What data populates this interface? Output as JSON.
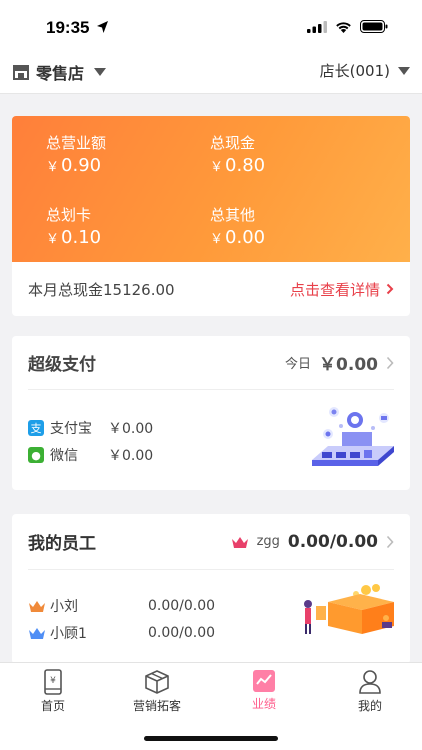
{
  "status_bar": {
    "time": "19:35"
  },
  "nav": {
    "store": "零售店",
    "role": "店长(001)"
  },
  "revenue": {
    "items": [
      {
        "label": "总营业额",
        "currency": "￥",
        "value": "0.90"
      },
      {
        "label": "总现金",
        "currency": "￥",
        "value": "0.80"
      },
      {
        "label": "总划卡",
        "currency": "￥",
        "value": "0.10"
      },
      {
        "label": "总其他",
        "currency": "￥",
        "value": "0.00"
      }
    ],
    "monthly_cash": "本月总现金15126.00",
    "detail_link": "点击查看详情"
  },
  "super_pay": {
    "title": "超级支付",
    "today_label": "今日",
    "today_value": "￥0.00",
    "rows": [
      {
        "name": "支付宝",
        "value": "￥0.00"
      },
      {
        "name": "微信",
        "value": "￥0.00"
      }
    ]
  },
  "staff": {
    "title": "我的员工",
    "lead_name": "zgg",
    "lead_value": "0.00/0.00",
    "rows": [
      {
        "name": "小刘",
        "value": "0.00/0.00"
      },
      {
        "name": "小顾1",
        "value": "0.00/0.00"
      }
    ]
  },
  "tabs": [
    {
      "label": "首页"
    },
    {
      "label": "营销拓客"
    },
    {
      "label": "业绩"
    },
    {
      "label": "我的"
    }
  ],
  "colors": {
    "accent": "#ff8c3a",
    "link": "#e8404a",
    "active_tab": "#ff5a8a",
    "alipay": "#1e9ee8",
    "wechat": "#3cb034"
  }
}
